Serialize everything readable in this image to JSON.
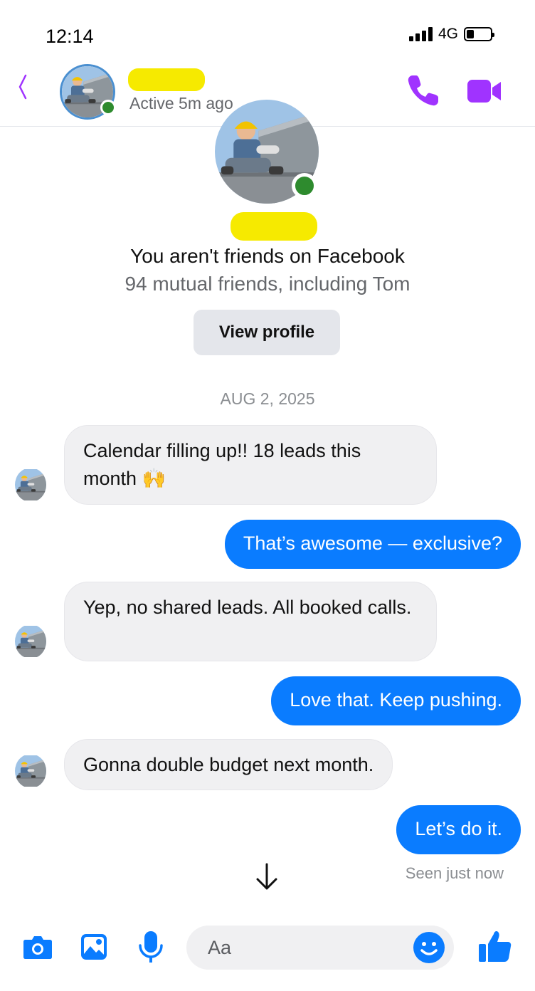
{
  "status_bar": {
    "time": "12:14",
    "network": "4G",
    "battery_level": 0.3
  },
  "header": {
    "status": "Active 5m ago",
    "accent_color": "#a033ff"
  },
  "profile": {
    "friend_status": "You aren't friends on Facebook",
    "mutual": "94 mutual friends, including Tom",
    "view_profile_label": "View profile"
  },
  "thread": {
    "date": "AUG 2, 2025",
    "messages": [
      {
        "from": "them",
        "text": "Calendar filling up!! 18 leads this month 🙌"
      },
      {
        "from": "me",
        "text": "That’s awesome — exclusive?"
      },
      {
        "from": "them",
        "text": "Yep, no shared leads. All booked calls."
      },
      {
        "from": "me",
        "text": "Love that. Keep pushing."
      },
      {
        "from": "them",
        "text": "Gonna double budget next month."
      },
      {
        "from": "me",
        "text": "Let’s do it."
      }
    ],
    "seen": "Seen just now",
    "outgoing_color": "#0a7cff"
  },
  "composer": {
    "placeholder": "Aa",
    "icons": [
      "camera-icon",
      "image-icon",
      "microphone-icon",
      "emoji-icon",
      "thumbs-up-icon"
    ]
  }
}
